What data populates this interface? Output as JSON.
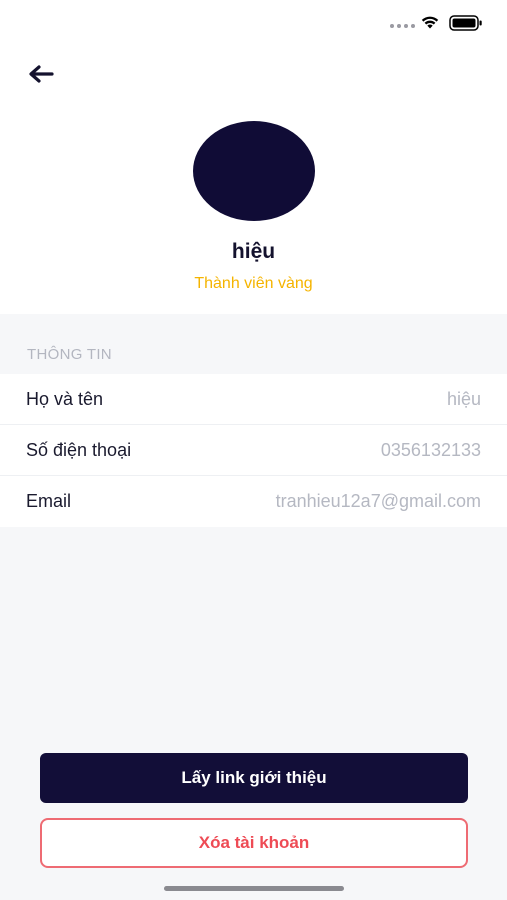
{
  "status_bar": {
    "icons": [
      "signal-dots-icon",
      "wifi-icon",
      "battery-icon"
    ]
  },
  "header": {
    "back_icon": "arrow-left-icon"
  },
  "profile": {
    "name": "hiệu",
    "membership": "Thành viên vàng",
    "avatar_color": "#100c36"
  },
  "info": {
    "section_title": "THÔNG TIN",
    "rows": [
      {
        "label": "Họ và tên",
        "value": "hiệu"
      },
      {
        "label": "Số điện thoại",
        "value": "0356132133"
      },
      {
        "label": "Email",
        "value": "tranhieu12a7@gmail.com"
      }
    ]
  },
  "actions": {
    "referral_label": "Lấy link giới thiệu",
    "delete_label": "Xóa tài khoản"
  },
  "colors": {
    "primary": "#120e38",
    "gold": "#f5b400",
    "danger": "#ee4b55"
  }
}
